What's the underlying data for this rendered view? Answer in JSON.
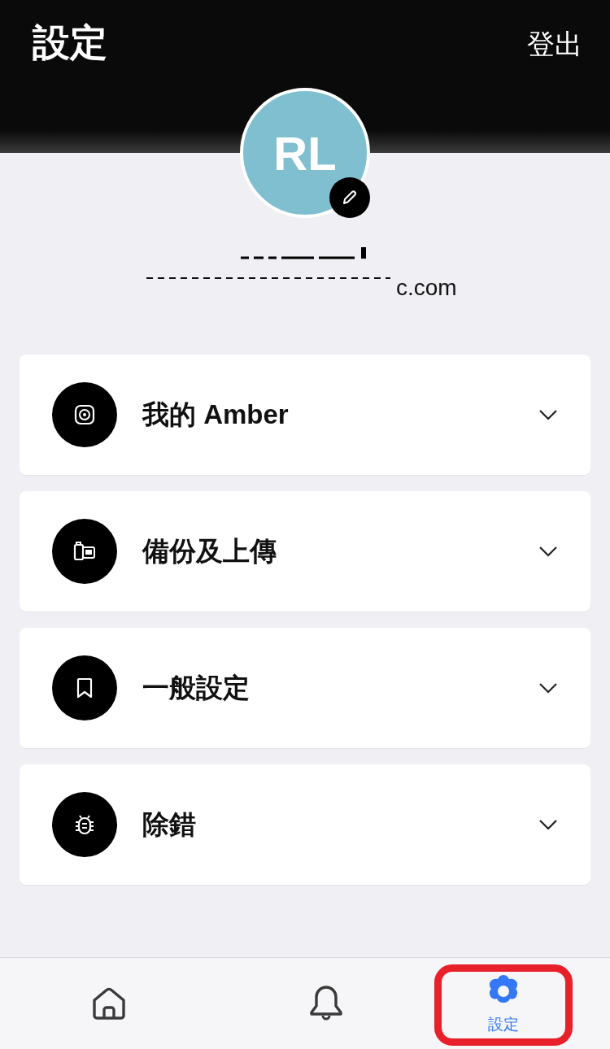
{
  "header": {
    "title": "設定",
    "logout": "登出"
  },
  "profile": {
    "initials": "RL",
    "email_visible": "c.com"
  },
  "sections": [
    {
      "label": "我的 Amber",
      "expanded": false
    },
    {
      "label": "備份及上傳",
      "expanded": false
    },
    {
      "label": "一般設定",
      "expanded": false
    },
    {
      "label": "除錯",
      "expanded": false
    }
  ],
  "tab_bar": [
    {
      "selected": false,
      "highlighted": false
    },
    {
      "selected": false,
      "highlighted": false
    },
    {
      "label": "設定",
      "selected": true,
      "highlighted": true
    }
  ]
}
